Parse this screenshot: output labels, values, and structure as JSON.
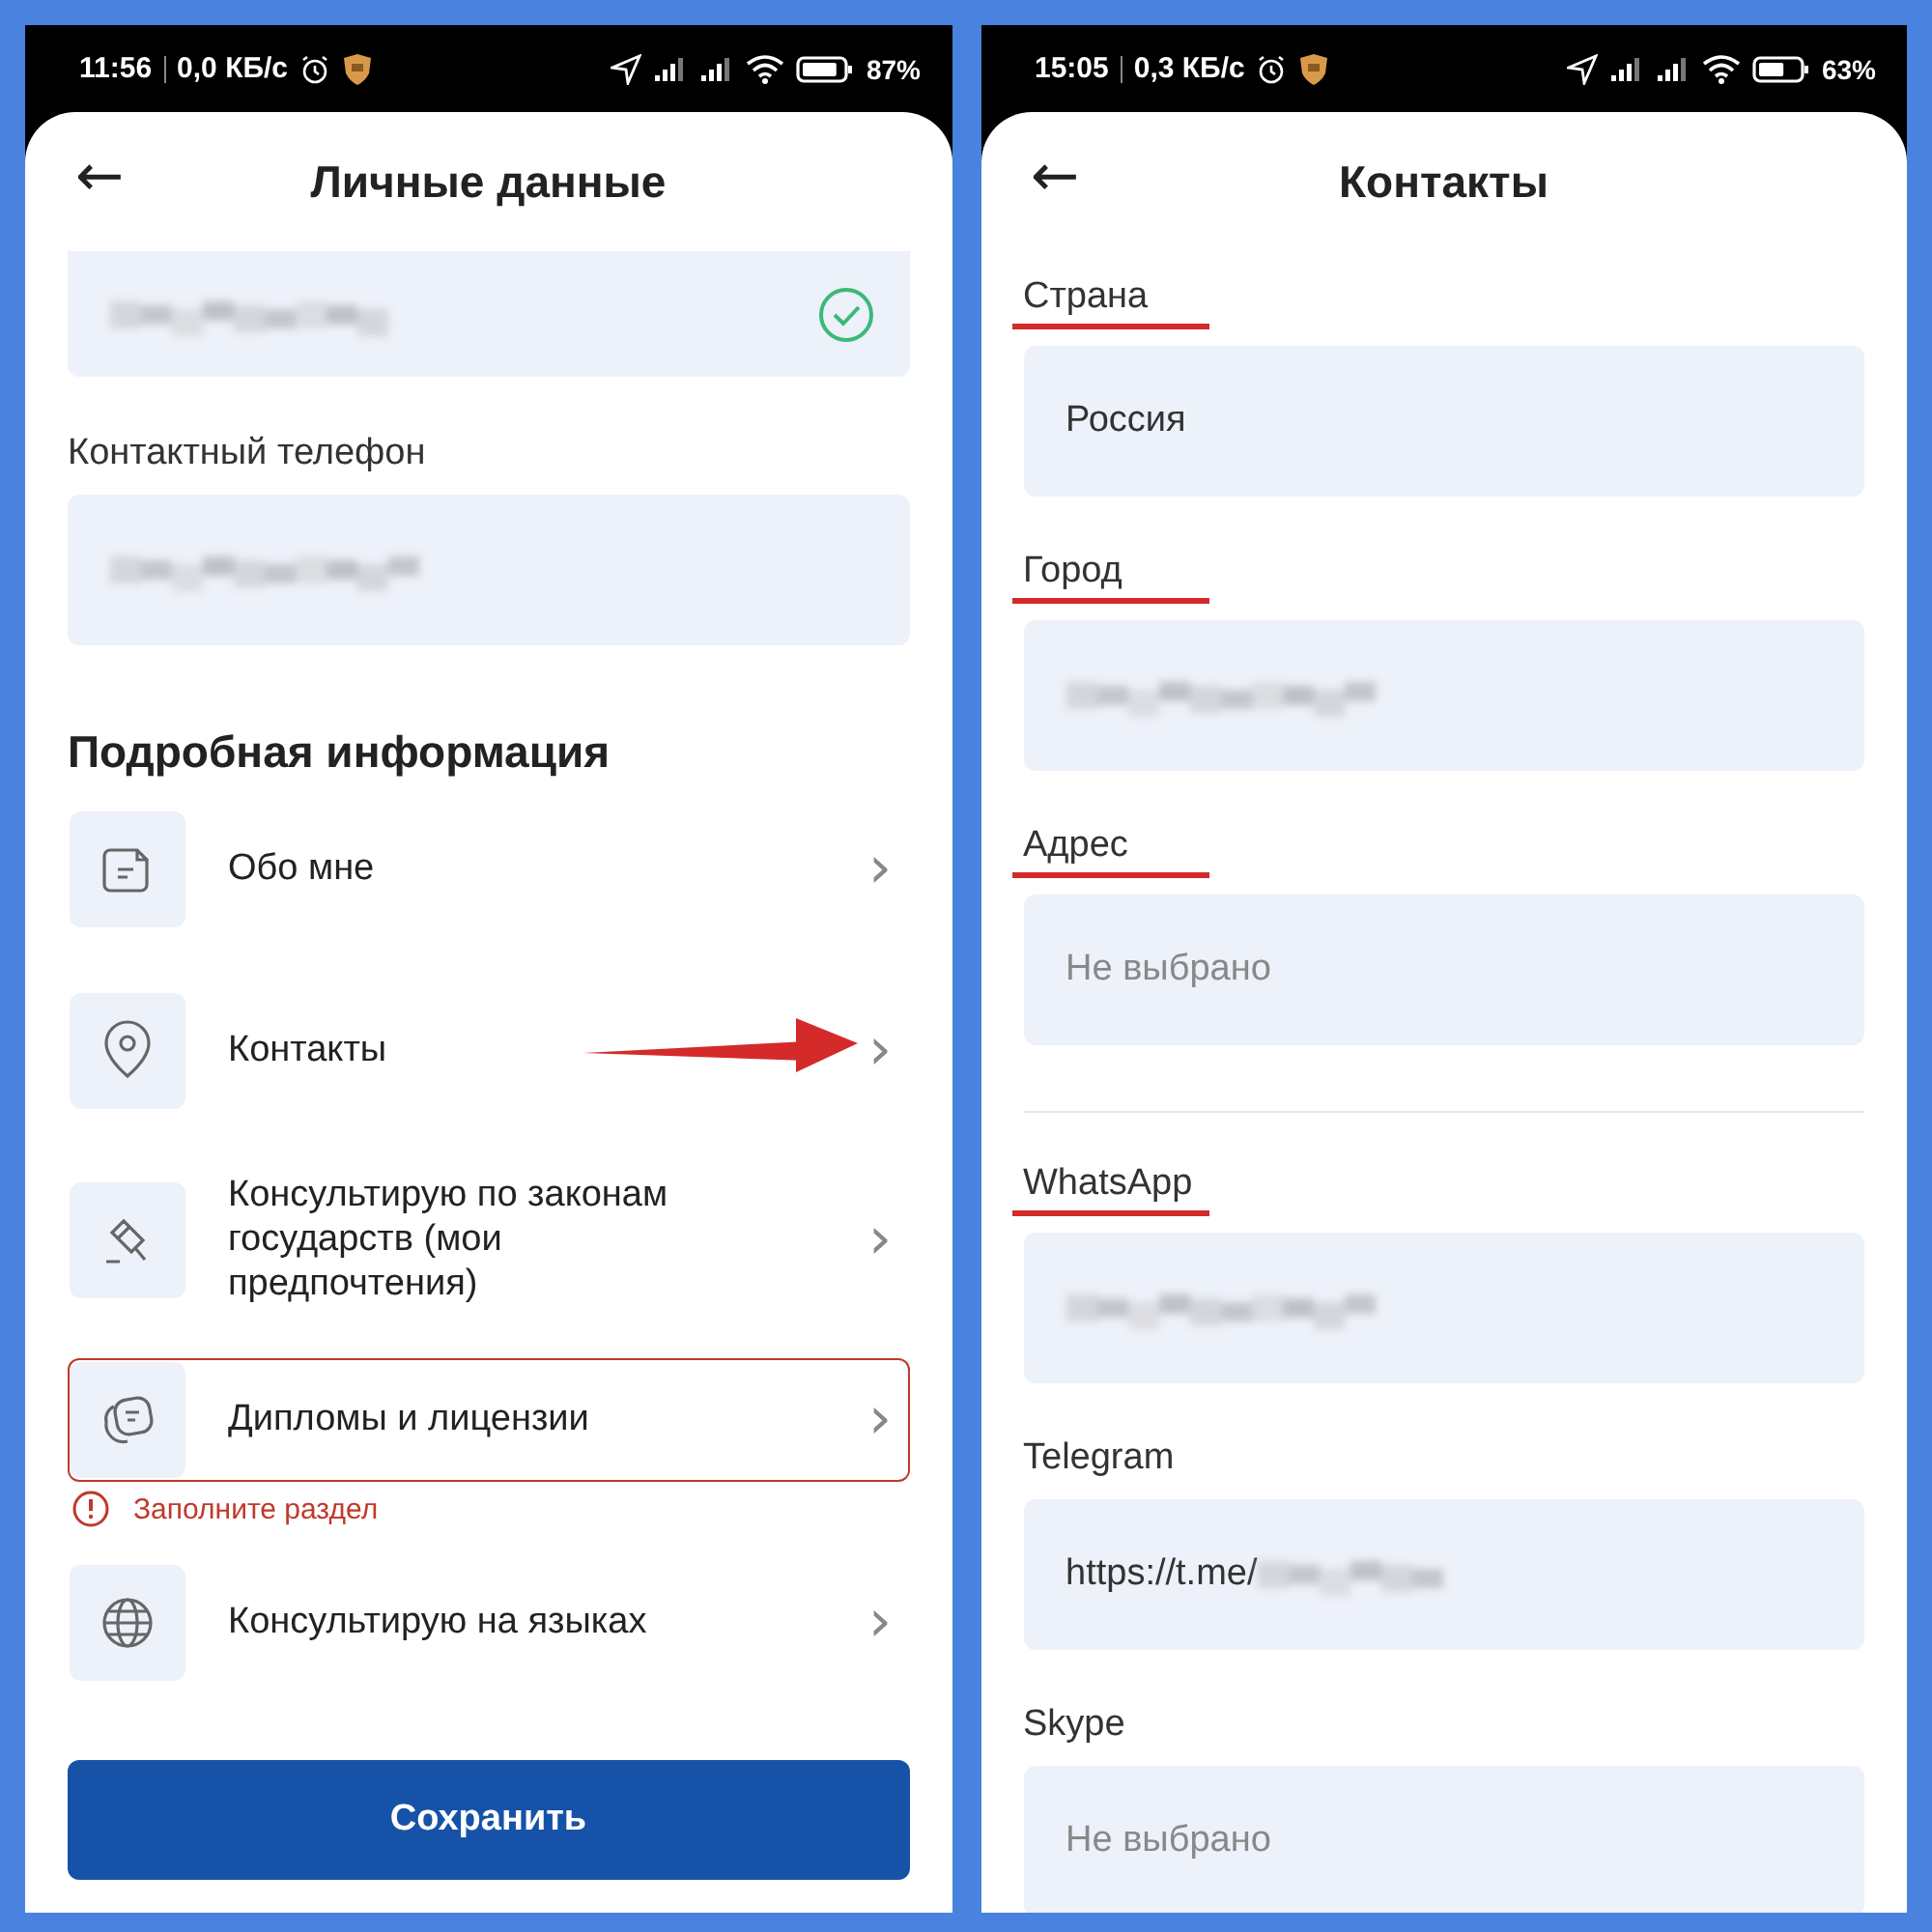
{
  "screens": [
    {
      "status_bar": {
        "time": "11:56",
        "speed": "0,0 КБ/с",
        "battery": "87%"
      },
      "header": {
        "back": "←",
        "title": "Личные данные"
      },
      "top_field": {
        "kind": "blurred",
        "verified": true
      },
      "fields": [
        {
          "label": "Контактный телефон",
          "underlined": false,
          "kind": "blurred",
          "divider_after": false
        }
      ],
      "section_title": "Подробная информация",
      "items": [
        {
          "label": "Обо мне",
          "chevron": "›",
          "error": false,
          "pointed": false
        },
        {
          "label": "Контакты",
          "chevron": "›",
          "error": false,
          "pointed": true
        },
        {
          "label": "Консультирую по законам государств (мои предпочтения)",
          "chevron": "›",
          "error": false,
          "pointed": false
        },
        {
          "label": "Дипломы и лицензии",
          "chevron": "›",
          "error": true,
          "error_text": "Заполните раздел",
          "pointed": false
        },
        {
          "label": "Консультирую на языках",
          "chevron": "›",
          "error": false,
          "pointed": false
        }
      ],
      "save_button": "Сохранить"
    },
    {
      "status_bar": {
        "time": "15:05",
        "speed": "0,3 КБ/с",
        "battery": "63%"
      },
      "header": {
        "back": "←",
        "title": "Контакты"
      },
      "fields": [
        {
          "label": "Страна",
          "underlined": true,
          "kind": "value",
          "value": "Россия",
          "divider_after": false
        },
        {
          "label": "Город",
          "underlined": true,
          "kind": "blurred",
          "divider_after": false
        },
        {
          "label": "Адрес",
          "underlined": true,
          "kind": "placeholder",
          "placeholder": "Не выбрано",
          "divider_after": true
        },
        {
          "label": "WhatsApp",
          "underlined": true,
          "kind": "blurred",
          "divider_after": false
        },
        {
          "label": "Telegram",
          "underlined": false,
          "kind": "value_blurred",
          "value": "https://t.me/",
          "divider_after": false
        },
        {
          "label": "Skype",
          "underlined": false,
          "kind": "placeholder",
          "placeholder": "Не выбрано",
          "divider_after": false
        }
      ]
    }
  ]
}
